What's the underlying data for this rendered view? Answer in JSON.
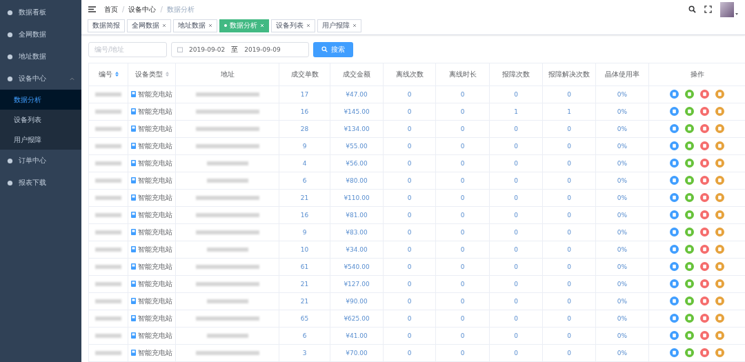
{
  "sidebar": {
    "items": [
      {
        "label": "数据看板",
        "selected": false
      },
      {
        "label": "全网数据",
        "selected": false
      },
      {
        "label": "地址数据",
        "selected": false
      },
      {
        "label": "设备中心",
        "selected": false,
        "expanded": true,
        "children": [
          {
            "label": "数据分析",
            "selected": true
          },
          {
            "label": "设备列表",
            "selected": false
          },
          {
            "label": "用户报障",
            "selected": false
          }
        ]
      },
      {
        "label": "订单中心",
        "selected": false
      },
      {
        "label": "报表下载",
        "selected": false
      }
    ]
  },
  "breadcrumb": {
    "separator": "/",
    "items": [
      "首页",
      "设备中心",
      "数据分析"
    ]
  },
  "tags": [
    {
      "label": "数据简报",
      "selected": false,
      "closable": false
    },
    {
      "label": "全网数据",
      "selected": false,
      "closable": true
    },
    {
      "label": "地址数据",
      "selected": false,
      "closable": true
    },
    {
      "label": "数据分析",
      "selected": true,
      "closable": true
    },
    {
      "label": "设备列表",
      "selected": false,
      "closable": true
    },
    {
      "label": "用户报障",
      "selected": false,
      "closable": true
    }
  ],
  "search": {
    "placeholder": "编号/地址",
    "start_date": "2019-09-02",
    "separator": "至",
    "end_date": "2019-09-09",
    "button": "搜索"
  },
  "table": {
    "columns": [
      {
        "label": "编号",
        "sortable": true
      },
      {
        "label": "设备类型",
        "sortable": true
      },
      {
        "label": "地址",
        "sortable": false
      },
      {
        "label": "成交单数",
        "sortable": false
      },
      {
        "label": "成交金额",
        "sortable": false
      },
      {
        "label": "离线次数",
        "sortable": false
      },
      {
        "label": "离线时长",
        "sortable": false
      },
      {
        "label": "报障次数",
        "sortable": false
      },
      {
        "label": "报障解决次数",
        "sortable": false
      },
      {
        "label": "晶体使用率",
        "sortable": false
      },
      {
        "label": "操作",
        "sortable": false
      }
    ],
    "rows": [
      {
        "type": "智能充电站",
        "values": [
          "17",
          "¥47.00",
          "0",
          "0",
          "0",
          "0",
          "0%"
        ]
      },
      {
        "type": "智能充电站",
        "values": [
          "16",
          "¥145.00",
          "0",
          "0",
          "1",
          "1",
          "0%"
        ]
      },
      {
        "type": "智能充电站",
        "values": [
          "28",
          "¥134.00",
          "0",
          "0",
          "0",
          "0",
          "0%"
        ]
      },
      {
        "type": "智能充电站",
        "values": [
          "9",
          "¥55.00",
          "0",
          "0",
          "0",
          "0",
          "0%"
        ]
      },
      {
        "type": "智能充电站",
        "values": [
          "4",
          "¥56.00",
          "0",
          "0",
          "0",
          "0",
          "0%"
        ]
      },
      {
        "type": "智能充电站",
        "values": [
          "6",
          "¥80.00",
          "0",
          "0",
          "0",
          "0",
          "0%"
        ]
      },
      {
        "type": "智能充电站",
        "values": [
          "21",
          "¥110.00",
          "0",
          "0",
          "0",
          "0",
          "0%"
        ]
      },
      {
        "type": "智能充电站",
        "values": [
          "16",
          "¥81.00",
          "0",
          "0",
          "0",
          "0",
          "0%"
        ]
      },
      {
        "type": "智能充电站",
        "values": [
          "9",
          "¥83.00",
          "0",
          "0",
          "0",
          "0",
          "0%"
        ]
      },
      {
        "type": "智能充电站",
        "values": [
          "10",
          "¥34.00",
          "0",
          "0",
          "0",
          "0",
          "0%"
        ]
      },
      {
        "type": "智能充电站",
        "values": [
          "61",
          "¥540.00",
          "0",
          "0",
          "0",
          "0",
          "0%"
        ]
      },
      {
        "type": "智能充电站",
        "values": [
          "21",
          "¥127.00",
          "0",
          "0",
          "0",
          "0",
          "0%"
        ]
      },
      {
        "type": "智能充电站",
        "values": [
          "21",
          "¥90.00",
          "0",
          "0",
          "0",
          "0",
          "0%"
        ]
      },
      {
        "type": "智能充电站",
        "values": [
          "65",
          "¥625.00",
          "0",
          "0",
          "0",
          "0",
          "0%"
        ]
      },
      {
        "type": "智能充电站",
        "values": [
          "6",
          "¥41.00",
          "0",
          "0",
          "0",
          "0",
          "0%"
        ]
      },
      {
        "type": "智能充电站",
        "values": [
          "3",
          "¥70.00",
          "0",
          "0",
          "0",
          "0",
          "0%"
        ]
      }
    ]
  }
}
